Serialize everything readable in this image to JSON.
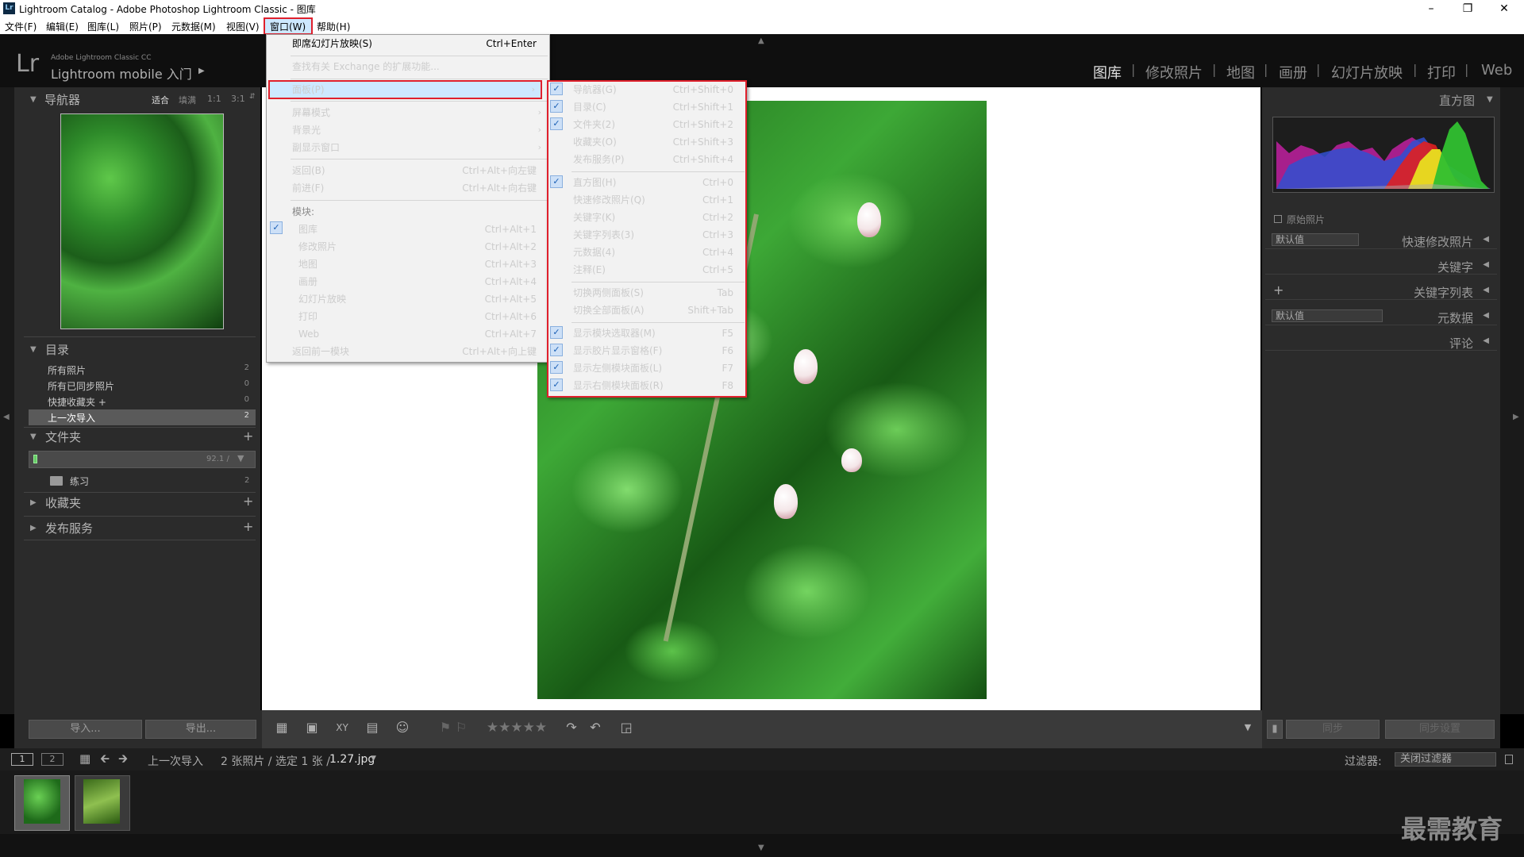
{
  "window": {
    "title": "Lightroom Catalog - Adobe Photoshop Lightroom Classic - 图库",
    "icon": "Lr"
  },
  "menubar": [
    "文件(F)",
    "编辑(E)",
    "图库(L)",
    "照片(P)",
    "元数据(M)",
    "视图(V)",
    "窗口(W)",
    "帮助(H)"
  ],
  "brand": {
    "logo": "Lr",
    "line1": "Adobe Lightroom Classic CC",
    "line2": "Lightroom mobile 入门"
  },
  "modules": [
    "图库",
    "修改照片",
    "地图",
    "画册",
    "幻灯片放映",
    "打印",
    "Web"
  ],
  "navigator": {
    "title": "导航器",
    "zoom": [
      "适合",
      "填满",
      "1:1",
      "3:1"
    ]
  },
  "catalog": {
    "title": "目录",
    "items": [
      {
        "label": "所有照片",
        "count": "2"
      },
      {
        "label": "所有已同步照片",
        "count": "0"
      },
      {
        "label": "快捷收藏夹 +",
        "count": "0"
      },
      {
        "label": "上一次导入",
        "count": "2"
      }
    ]
  },
  "folders": {
    "title": "文件夹",
    "volume": "92.1 /",
    "folder": "练习",
    "folder_count": "2"
  },
  "collections": {
    "title": "收藏夹"
  },
  "publish": {
    "title": "发布服务"
  },
  "left_buttons": {
    "import": "导入...",
    "export": "导出..."
  },
  "window_menu": {
    "items": [
      {
        "label": "即席幻灯片放映(S)",
        "shortcut": "Ctrl+Enter"
      },
      {
        "label": "查找有关 Exchange 的扩展功能...",
        "shortcut": ""
      },
      {
        "label": "面板(P)",
        "shortcut": ""
      },
      {
        "label": "屏幕模式",
        "shortcut": ""
      },
      {
        "label": "背景光",
        "shortcut": ""
      },
      {
        "label": "副显示窗口",
        "shortcut": ""
      },
      {
        "label": "返回(B)",
        "shortcut": "Ctrl+Alt+向左键"
      },
      {
        "label": "前进(F)",
        "shortcut": "Ctrl+Alt+向右键"
      }
    ],
    "modules_header": "模块:",
    "modules": [
      {
        "label": "图库",
        "shortcut": "Ctrl+Alt+1"
      },
      {
        "label": "修改照片",
        "shortcut": "Ctrl+Alt+2"
      },
      {
        "label": "地图",
        "shortcut": "Ctrl+Alt+3"
      },
      {
        "label": "画册",
        "shortcut": "Ctrl+Alt+4"
      },
      {
        "label": "幻灯片放映",
        "shortcut": "Ctrl+Alt+5"
      },
      {
        "label": "打印",
        "shortcut": "Ctrl+Alt+6"
      },
      {
        "label": "Web",
        "shortcut": "Ctrl+Alt+7"
      },
      {
        "label": "返回前一模块",
        "shortcut": "Ctrl+Alt+向上键"
      }
    ]
  },
  "panels_submenu": {
    "items": [
      {
        "label": "导航器(G)",
        "shortcut": "Ctrl+Shift+0"
      },
      {
        "label": "目录(C)",
        "shortcut": "Ctrl+Shift+1"
      },
      {
        "label": "文件夹(2)",
        "shortcut": "Ctrl+Shift+2"
      },
      {
        "label": "收藏夹(O)",
        "shortcut": "Ctrl+Shift+3"
      },
      {
        "label": "发布服务(P)",
        "shortcut": "Ctrl+Shift+4"
      },
      {
        "label": "直方图(H)",
        "shortcut": "Ctrl+0"
      },
      {
        "label": "快速修改照片(Q)",
        "shortcut": "Ctrl+1"
      },
      {
        "label": "关键字(K)",
        "shortcut": "Ctrl+2"
      },
      {
        "label": "关键字列表(3)",
        "shortcut": "Ctrl+3"
      },
      {
        "label": "元数据(4)",
        "shortcut": "Ctrl+4"
      },
      {
        "label": "注释(E)",
        "shortcut": "Ctrl+5"
      },
      {
        "label": "切换两侧面板(S)",
        "shortcut": "Tab"
      },
      {
        "label": "切换全部面板(A)",
        "shortcut": "Shift+Tab"
      },
      {
        "label": "显示模块选取器(M)",
        "shortcut": "F5"
      },
      {
        "label": "显示胶片显示窗格(F)",
        "shortcut": "F6"
      },
      {
        "label": "显示左侧模块面板(L)",
        "shortcut": "F7"
      },
      {
        "label": "显示右侧模块面板(R)",
        "shortcut": "F8"
      }
    ]
  },
  "right_panel": {
    "histogram": "直方图",
    "original_photo": "原始照片",
    "preset_default": "默认值",
    "quick_develop": "快速修改照片",
    "keywords": "关键字",
    "keyword_list": "关键字列表",
    "metadata_default": "默认值",
    "metadata": "元数据",
    "comments": "评论",
    "sync": "同步",
    "sync_settings": "同步设置"
  },
  "filmbar": {
    "page1": "1",
    "page2": "2",
    "source": "上一次导入",
    "info": "2 张照片 / 选定 1 张 /",
    "filename": "1.27.jpg",
    "filter_label": "过滤器:",
    "filter_value": "关闭过滤器"
  },
  "watermark": "最需教育"
}
